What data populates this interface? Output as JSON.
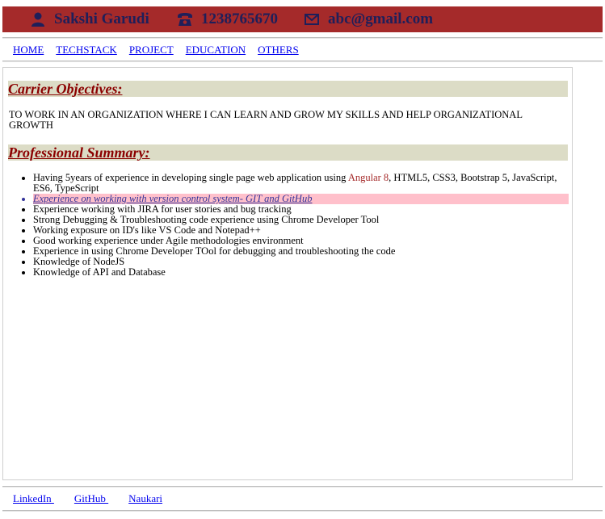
{
  "colors": {
    "header_bg": "#a52a2a",
    "header_text": "#1f1f5a",
    "section_heading_bg": "#dcdcc6",
    "section_heading_text": "#8b0000",
    "highlight_bg": "#ffc0cb",
    "link": "#0000ee",
    "accent": "#a52a2a"
  },
  "header": {
    "name": "Sakshi Garudi",
    "name_icon": "person-icon",
    "phone": "1238765670",
    "phone_icon": "phone-icon",
    "email": "abc@gmail.com",
    "email_icon": "envelope-icon"
  },
  "nav": {
    "items": [
      "HOME",
      "TECHSTACK",
      "PROJECT",
      "EDUCATION",
      "OTHERS"
    ]
  },
  "objectives": {
    "heading": "Carrier Objectives:",
    "text": "TO WORK IN AN ORGANIZATION WHERE I CAN LEARN AND GROW MY SKILLS AND HELP ORGANIZATIONAL GROWTH"
  },
  "summary": {
    "heading": "Professional Summary:",
    "item0_before": "Having 5years of experience in developing single page web application using ",
    "item0_accent": "Angular 8",
    "item0_after": ", HTML5, CSS3, Bootstrap 5, JavaScript, ES6, TypeScript",
    "items": [
      "Experience on working with version control system- GIT and GitHub",
      "Experience working with JIRA for user stories and bug tracking",
      "Strong Debugging & Troubleshooting code experience using Chrome Developer Tool",
      "Working exposure on ID's like VS Code and Notepad++",
      "Good working experience under Agile methodologies environment",
      "Experience in using Chrome Developer TOol for debugging and troubleshooting the code",
      "Knowledge of NodeJS",
      "Knowledge of API and Database"
    ]
  },
  "footer": {
    "links": [
      "LinkedIn ",
      "GitHub ",
      "Naukari"
    ]
  }
}
